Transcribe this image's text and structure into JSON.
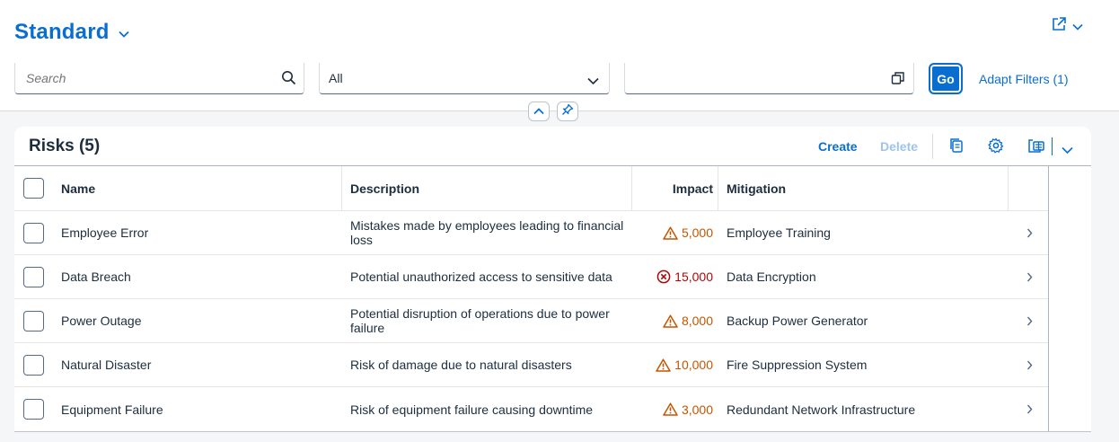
{
  "header": {
    "variant_title": "Standard"
  },
  "filters": {
    "search_placeholder": "Search",
    "status_value": "All",
    "value_help_value": "",
    "go_label": "Go",
    "adapt_label": "Adapt Filters (1)"
  },
  "table": {
    "title": "Risks (5)",
    "create_label": "Create",
    "delete_label": "Delete",
    "columns": [
      "Name",
      "Description",
      "Impact",
      "Mitigation"
    ],
    "rows": [
      {
        "name": "Employee Error",
        "description": "Mistakes made by employees leading to financial loss",
        "impact": "5,000",
        "impact_state": "warning",
        "mitigation": "Employee Training"
      },
      {
        "name": "Data Breach",
        "description": "Potential unauthorized access to sensitive data",
        "impact": "15,000",
        "impact_state": "error",
        "mitigation": "Data Encryption"
      },
      {
        "name": "Power Outage",
        "description": "Potential disruption of operations due to power failure",
        "impact": "8,000",
        "impact_state": "warning",
        "mitigation": "Backup Power Generator"
      },
      {
        "name": "Natural Disaster",
        "description": "Risk of damage due to natural disasters",
        "impact": "10,000",
        "impact_state": "warning",
        "mitigation": "Fire Suppression System"
      },
      {
        "name": "Equipment Failure",
        "description": "Risk of equipment failure causing downtime",
        "impact": "3,000",
        "impact_state": "warning",
        "mitigation": "Redundant Network Infrastructure"
      }
    ]
  },
  "icons": {
    "variant": "chevron-down-icon",
    "share": "share-icon",
    "search": "search-icon",
    "dropdown": "chevron-down-icon",
    "value_help": "value-help-icon",
    "collapse": "chevron-up-icon",
    "pin": "pin-icon",
    "copy": "copy-icon",
    "settings": "gear-icon",
    "export": "export-icon",
    "row_nav": "chevron-right-icon",
    "warning": "warning-triangle-icon",
    "error": "error-circle-icon"
  },
  "colors": {
    "accent": "#0a6ed1",
    "warning": "#c35500",
    "error": "#aa0808",
    "disabled": "#9cc4ec"
  }
}
